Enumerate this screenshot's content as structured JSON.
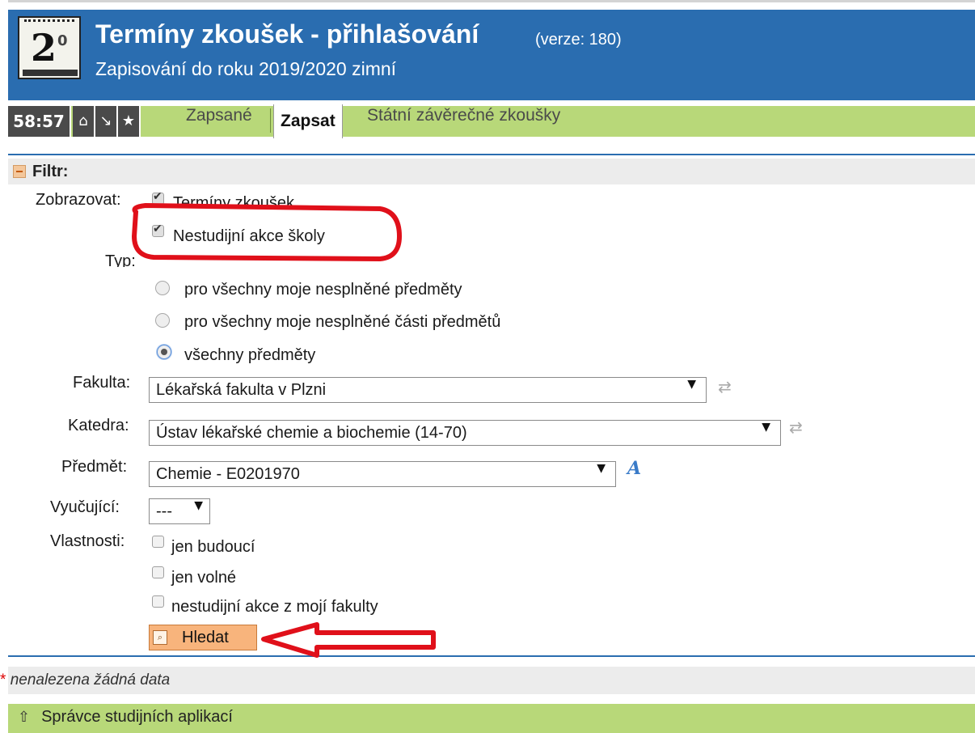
{
  "header": {
    "title": "Termíny zkoušek - přihlašování",
    "version": "(verze: 180)",
    "subtitle": "Zapisování do roku 2019/2020 zimní",
    "logo_icon": "calendar-icon"
  },
  "nav": {
    "timer": "58:57",
    "icons": [
      "home-icon",
      "download-icon",
      "star-icon"
    ],
    "tabs": [
      {
        "label": "Zapsané",
        "active": false
      },
      {
        "label": "Zapsat",
        "active": true
      },
      {
        "label": "Státní závěrečné zkoušky",
        "active": false
      }
    ]
  },
  "filter": {
    "title": "Filtr:",
    "show_label": "Zobrazovat:",
    "show_options": [
      {
        "label": "Termíny zkoušek",
        "checked": true
      },
      {
        "label": "Nestudijní akce školy",
        "checked": true
      }
    ],
    "type_label": "Typ:",
    "type_options": [
      {
        "label": "pro všechny moje nesplněné předměty",
        "selected": false
      },
      {
        "label": "pro všechny moje nesplněné části předmětů",
        "selected": false
      },
      {
        "label": "všechny předměty",
        "selected": true
      }
    ],
    "faculty_label": "Fakulta:",
    "faculty_value": "Lékařská fakulta v Plzni",
    "department_label": "Katedra:",
    "department_value": "Ústav lékařské chemie a biochemie (14-70)",
    "subject_label": "Předmět:",
    "subject_value": "Chemie - E0201970",
    "teacher_label": "Vyučující:",
    "teacher_value": "---",
    "props_label": "Vlastnosti:",
    "props_options": [
      {
        "label": "jen budoucí",
        "checked": false
      },
      {
        "label": "jen volné",
        "checked": false
      },
      {
        "label": "nestudijní akce z mojí fakulty",
        "checked": false
      }
    ],
    "search_button": "Hledat"
  },
  "message": {
    "star": "*",
    "text": "nenalezena žádná data"
  },
  "footer": {
    "link": "Správce studijních aplikací"
  },
  "colors": {
    "header_blue": "#2a6db0",
    "nav_green": "#b8d879",
    "button_orange": "#f8b47c",
    "annotation_red": "#e0101a"
  }
}
